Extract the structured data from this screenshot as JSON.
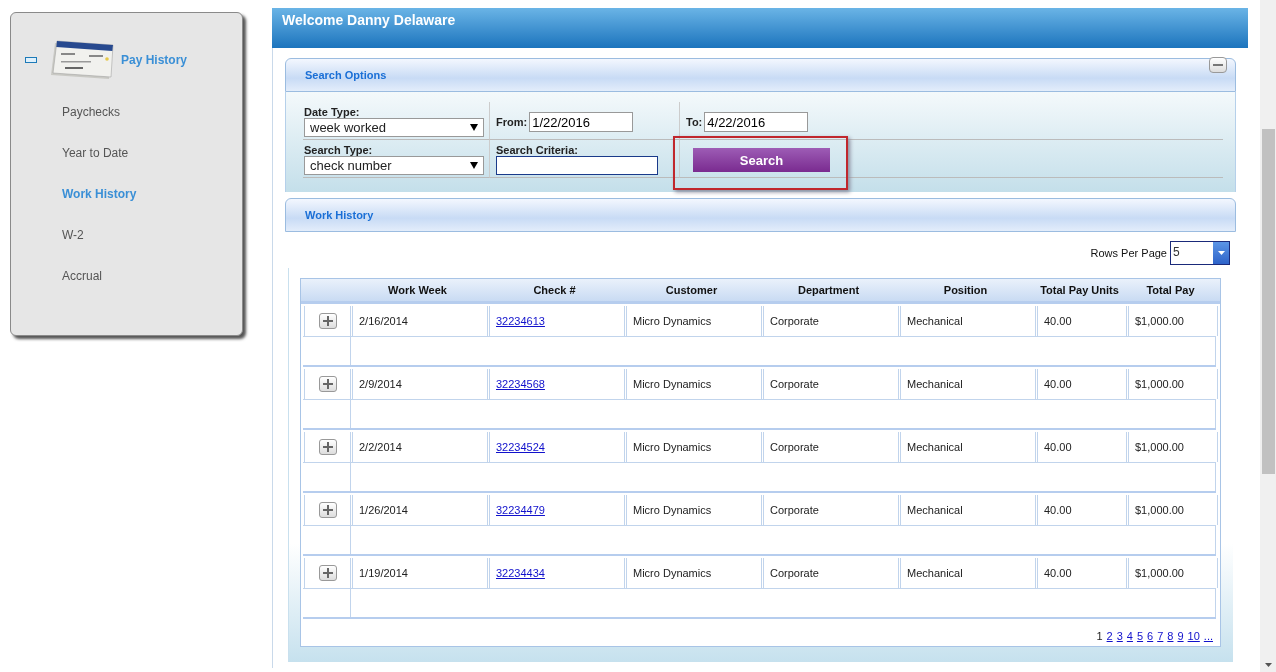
{
  "header": {
    "title": "Welcome Danny Delaware"
  },
  "sidebar": {
    "group": {
      "label": "Pay History",
      "expanded": true
    },
    "items": [
      {
        "label": "Paychecks",
        "selected": false
      },
      {
        "label": "Year to Date",
        "selected": false
      },
      {
        "label": "Work History",
        "selected": true
      },
      {
        "label": "W-2",
        "selected": false
      },
      {
        "label": "Accrual",
        "selected": false
      }
    ]
  },
  "search_options": {
    "title": "Search Options",
    "date_type": {
      "label": "Date Type:",
      "value": "week worked"
    },
    "from": {
      "label": "From:",
      "value": "1/22/2016"
    },
    "to": {
      "label": "To:",
      "value": "4/22/2016"
    },
    "search_type": {
      "label": "Search Type:",
      "value": "check number"
    },
    "search_criteria": {
      "label": "Search Criteria:"
    },
    "search_button": {
      "label": "Search",
      "highlighted": true
    }
  },
  "work_history": {
    "title": "Work History",
    "rows_per_page": {
      "label": "Rows Per Page",
      "value": "5"
    },
    "table": {
      "columns": [
        "Work Week",
        "Check #",
        "Customer",
        "Department",
        "Position",
        "Total Pay Units",
        "Total Pay"
      ],
      "rows": [
        {
          "expanded": false,
          "work_week": "2/16/2014",
          "check": "32234613",
          "customer": "Micro Dynamics",
          "department": "Corporate",
          "position": "Mechanical",
          "total_pay_units": "40.00",
          "total_pay": "$1,000.00"
        },
        {
          "expanded": false,
          "work_week": "2/9/2014",
          "check": "32234568",
          "customer": "Micro Dynamics",
          "department": "Corporate",
          "position": "Mechanical",
          "total_pay_units": "40.00",
          "total_pay": "$1,000.00"
        },
        {
          "expanded": false,
          "work_week": "2/2/2014",
          "check": "32234524",
          "customer": "Micro Dynamics",
          "department": "Corporate",
          "position": "Mechanical",
          "total_pay_units": "40.00",
          "total_pay": "$1,000.00"
        },
        {
          "expanded": false,
          "work_week": "1/26/2014",
          "check": "32234479",
          "customer": "Micro Dynamics",
          "department": "Corporate",
          "position": "Mechanical",
          "total_pay_units": "40.00",
          "total_pay": "$1,000.00"
        },
        {
          "expanded": false,
          "work_week": "1/19/2014",
          "check": "32234434",
          "customer": "Micro Dynamics",
          "department": "Corporate",
          "position": "Mechanical",
          "total_pay_units": "40.00",
          "total_pay": "$1,000.00"
        }
      ]
    },
    "pager": [
      {
        "label": "1",
        "selected": true
      },
      {
        "label": "2",
        "selected": false
      },
      {
        "label": "3",
        "selected": false
      },
      {
        "label": "4",
        "selected": false
      },
      {
        "label": "5",
        "selected": false
      },
      {
        "label": "6",
        "selected": false
      },
      {
        "label": "7",
        "selected": false
      },
      {
        "label": "8",
        "selected": false
      },
      {
        "label": "9",
        "selected": false
      },
      {
        "label": "10",
        "selected": false
      },
      {
        "label": "...",
        "selected": false
      }
    ]
  }
}
